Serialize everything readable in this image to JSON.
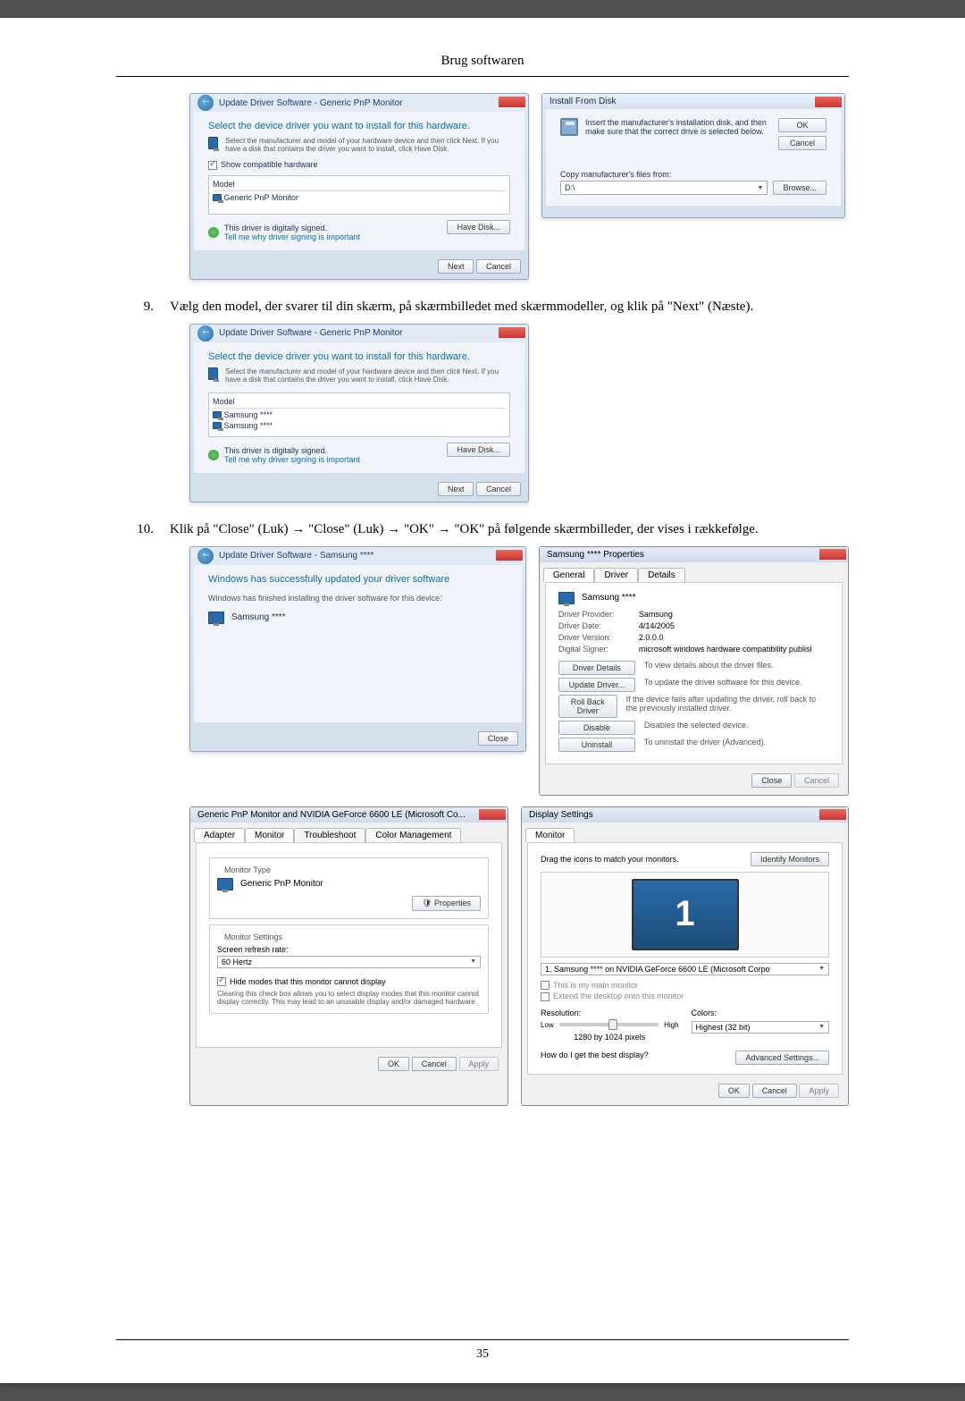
{
  "doc": {
    "header": "Brug softwaren",
    "page_number": "35"
  },
  "step9": {
    "num": "9.",
    "text": "Vælg den model, der svarer til din skærm, på skærmbilledet med skærmmodeller, og klik på \"Next\" (Næste)."
  },
  "step10": {
    "num": "10.",
    "text": "Klik på \"Close\" (Luk) → \"Close\" (Luk) → \"OK\" → \"OK\" på følgende skærmbilleder, der vises i rækkefølge."
  },
  "win_update1": {
    "crumb": "Update Driver Software - Generic PnP Monitor",
    "heading": "Select the device driver you want to install for this hardware.",
    "sub": "Select the manufacturer and model of your hardware device and then click Next. If you have a disk that contains the driver you want to install, click Have Disk.",
    "show_compat": "Show compatible hardware",
    "col_model": "Model",
    "item": "Generic PnP Monitor",
    "signed": "This driver is digitally signed.",
    "tell": "Tell me why driver signing is important",
    "havedisk": "Have Disk...",
    "next": "Next",
    "cancel": "Cancel"
  },
  "win_install": {
    "title": "Install From Disk",
    "insert": "Insert the manufacturer's installation disk, and then make sure that the correct drive is selected below.",
    "copy": "Copy manufacturer's files from:",
    "path": "D:\\",
    "ok": "OK",
    "cancel": "Cancel",
    "browse": "Browse..."
  },
  "win_update2": {
    "crumb": "Update Driver Software - Generic PnP Monitor",
    "heading": "Select the device driver you want to install for this hardware.",
    "sub": "Select the manufacturer and model of your hardware device and then click Next. If you have a disk that contains the driver you want to install, click Have Disk.",
    "col_model": "Model",
    "item1": "Samsung ****",
    "item2": "Samsung ****",
    "signed": "This driver is digitally signed.",
    "tell": "Tell me why driver signing is important",
    "havedisk": "Have Disk...",
    "next": "Next",
    "cancel": "Cancel"
  },
  "win_success": {
    "crumb": "Update Driver Software - Samsung ****",
    "heading": "Windows has successfully updated your driver software",
    "sub": "Windows has finished installing the driver software for this device:",
    "device": "Samsung ****",
    "close": "Close"
  },
  "win_props": {
    "title": "Samsung **** Properties",
    "tab1": "General",
    "tab2": "Driver",
    "tab3": "Details",
    "device": "Samsung ****",
    "provider_l": "Driver Provider:",
    "provider_v": "Samsung",
    "date_l": "Driver Date:",
    "date_v": "4/14/2005",
    "ver_l": "Driver Version:",
    "ver_v": "2.0.0.0",
    "signer_l": "Digital Signer:",
    "signer_v": "microsoft windows hardware compatibility publisl",
    "b_details": "Driver Details",
    "b_details_d": "To view details about the driver files.",
    "b_update": "Update Driver...",
    "b_update_d": "To update the driver software for this device.",
    "b_roll": "Roll Back Driver",
    "b_roll_d": "If the device fails after updating the driver, roll back to the previously installed driver.",
    "b_disable": "Disable",
    "b_disable_d": "Disables the selected device.",
    "b_uninst": "Uninstall",
    "b_uninst_d": "To uninstall the driver (Advanced).",
    "close": "Close",
    "cancel": "Cancel"
  },
  "win_monitor": {
    "title": "Generic PnP Monitor and NVIDIA GeForce 6600 LE (Microsoft Co...",
    "tab1": "Adapter",
    "tab2": "Monitor",
    "tab3": "Troubleshoot",
    "tab4": "Color Management",
    "mtype": "Monitor Type",
    "mname": "Generic PnP Monitor",
    "props": "Properties",
    "msettings": "Monitor Settings",
    "refresh_l": "Screen refresh rate:",
    "refresh_v": "60 Hertz",
    "hide": "Hide modes that this monitor cannot display",
    "hide_desc": "Clearing this check box allows you to select display modes that this monitor cannot display correctly. This may lead to an unusable display and/or damaged hardware.",
    "ok": "OK",
    "cancel": "Cancel",
    "apply": "Apply"
  },
  "win_display": {
    "title": "Display Settings",
    "tab": "Monitor",
    "drag": "Drag the icons to match your monitors.",
    "identify": "Identify Monitors",
    "mon_num": "1",
    "sel": "1. Samsung **** on NVIDIA GeForce 6600 LE (Microsoft Corpo",
    "main": "This is my main monitor",
    "extend": "Extend the desktop onto this monitor",
    "res_l": "Resolution:",
    "col_l": "Colors:",
    "low": "Low",
    "high": "High",
    "res_v": "1280 by 1024 pixels",
    "col_v": "Highest (32 bit)",
    "best": "How do I get the best display?",
    "adv": "Advanced Settings...",
    "ok": "OK",
    "cancel": "Cancel",
    "apply": "Apply"
  }
}
